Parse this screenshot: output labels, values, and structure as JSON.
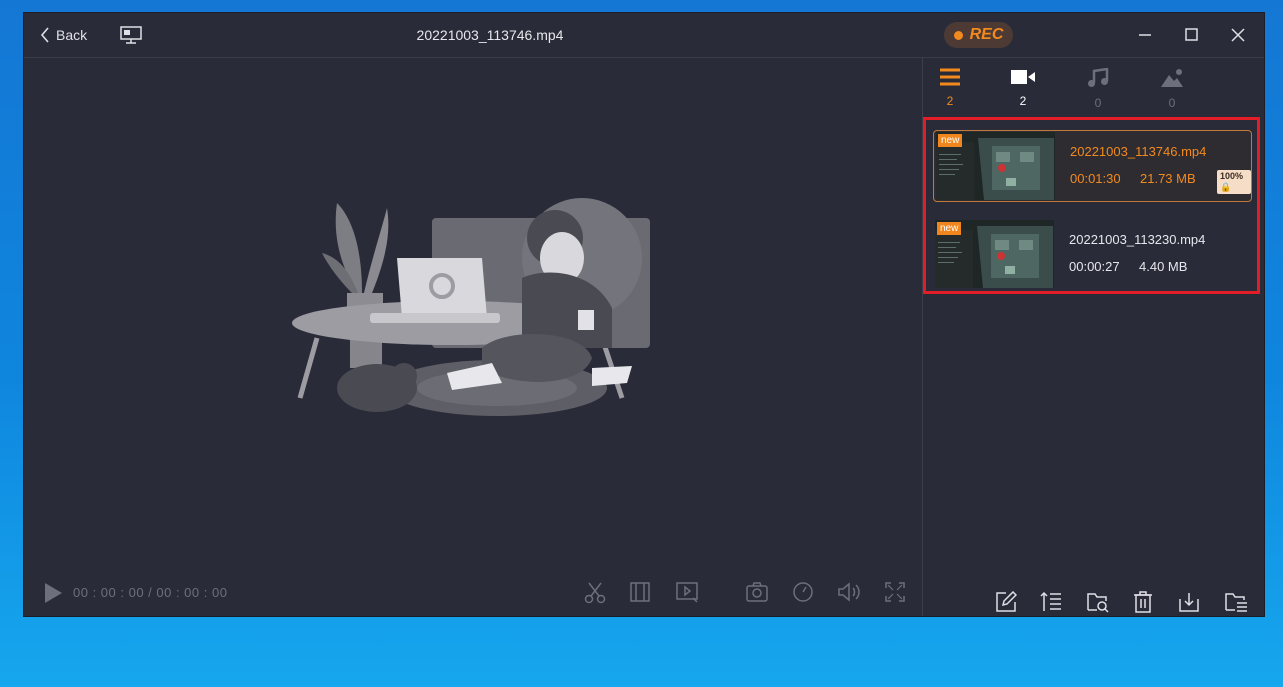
{
  "titlebar": {
    "back_label": "Back",
    "file_title": "20221003_113746.mp4",
    "rec_label": "REC"
  },
  "player": {
    "time_display": "00 : 00 : 00 / 00 : 00 : 00"
  },
  "tabs": [
    {
      "name": "all",
      "icon": "list-icon",
      "count": "2",
      "color": "#f28a1e"
    },
    {
      "name": "video",
      "icon": "video-camera-icon",
      "count": "2",
      "color": "#ffffff"
    },
    {
      "name": "audio",
      "icon": "music-note-icon",
      "count": "0",
      "color": "#6d6f7c"
    },
    {
      "name": "image",
      "icon": "image-icon",
      "count": "0",
      "color": "#6d6f7c"
    }
  ],
  "recordings": [
    {
      "badge": "new",
      "name": "20221003_113746.mp4",
      "duration": "00:01:30",
      "size": "21.73 MB",
      "progress_badge": "100%",
      "selected": true
    },
    {
      "badge": "new",
      "name": "20221003_113230.mp4",
      "duration": "00:00:27",
      "size": "4.40 MB",
      "selected": false
    }
  ],
  "colors": {
    "accent": "#f28a1e",
    "window_bg": "#2a2b38",
    "highlight_border": "#e31d26"
  }
}
